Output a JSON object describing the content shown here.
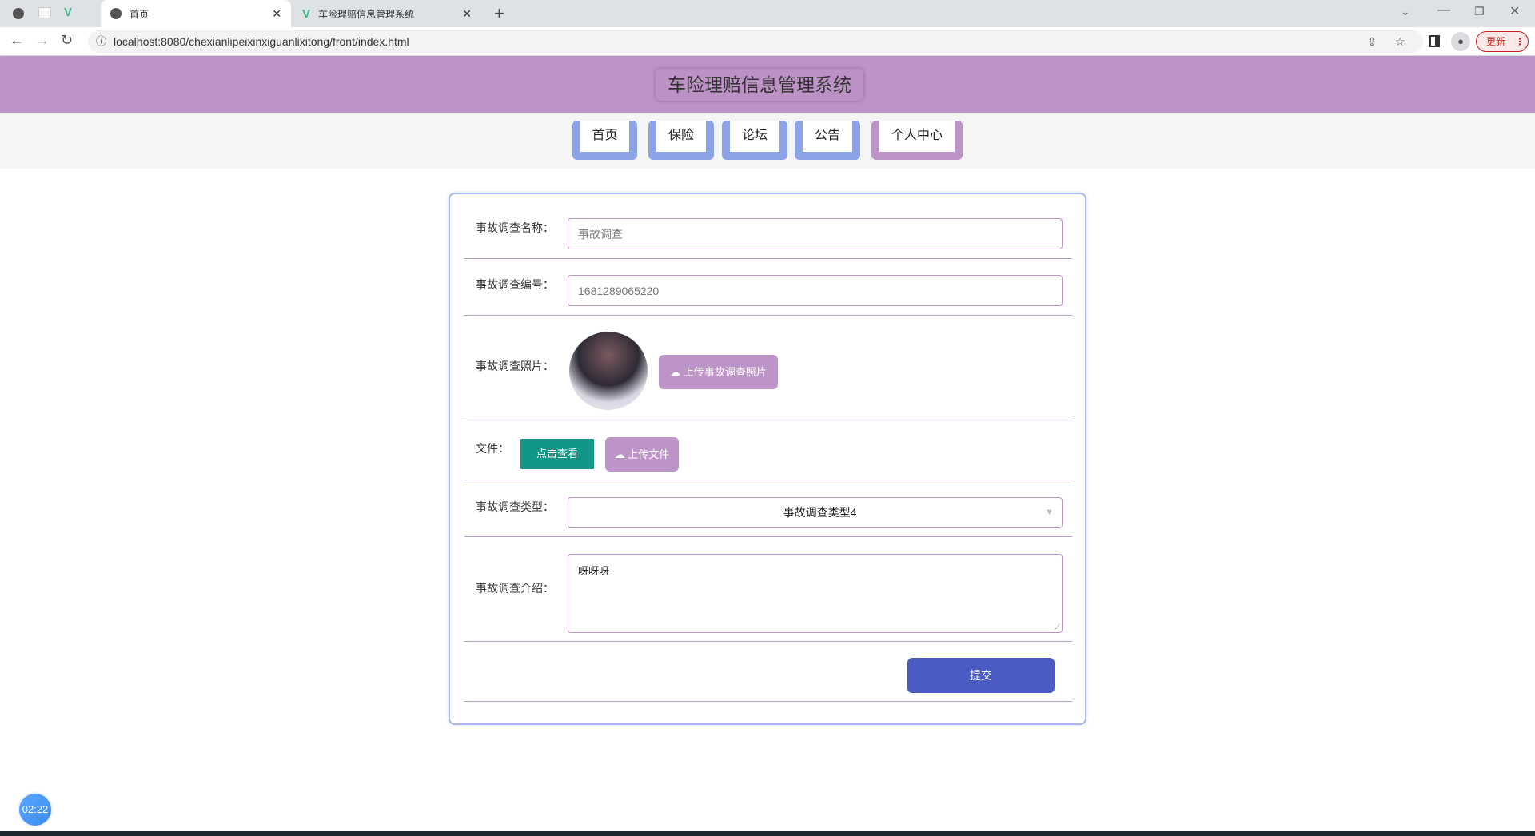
{
  "browser": {
    "tabs": [
      {
        "label": "首页",
        "active": true
      },
      {
        "label": "车险理赔信息管理系统",
        "active": false
      }
    ],
    "url": "localhost:8080/chexianlipeixinxiguanlixitong/front/index.html",
    "update_label": "更新"
  },
  "header": {
    "title": "车险理赔信息管理系统"
  },
  "nav": {
    "items": [
      {
        "label": "首页"
      },
      {
        "label": "保险"
      },
      {
        "label": "论坛"
      },
      {
        "label": "公告"
      },
      {
        "label": "个人中心"
      }
    ]
  },
  "form": {
    "name": {
      "label": "事故调查名称：",
      "placeholder": "事故调查"
    },
    "number": {
      "label": "事故调查编号：",
      "placeholder": "1681289065220"
    },
    "photo": {
      "label": "事故调查照片：",
      "upload_label": "上传事故调查照片"
    },
    "file": {
      "label": "文件：",
      "view_label": "点击查看",
      "upload_label": "上传文件"
    },
    "type": {
      "label": "事故调查类型：",
      "value": "事故调查类型4"
    },
    "intro": {
      "label": "事故调查介绍：",
      "value": "呀呀呀"
    },
    "submit_label": "提交"
  },
  "timer": "02:22",
  "colors": {
    "header": "#bd94c7",
    "nav_blue": "#8ca3e8",
    "view_button": "#119688",
    "submit": "#4a5bc4"
  }
}
